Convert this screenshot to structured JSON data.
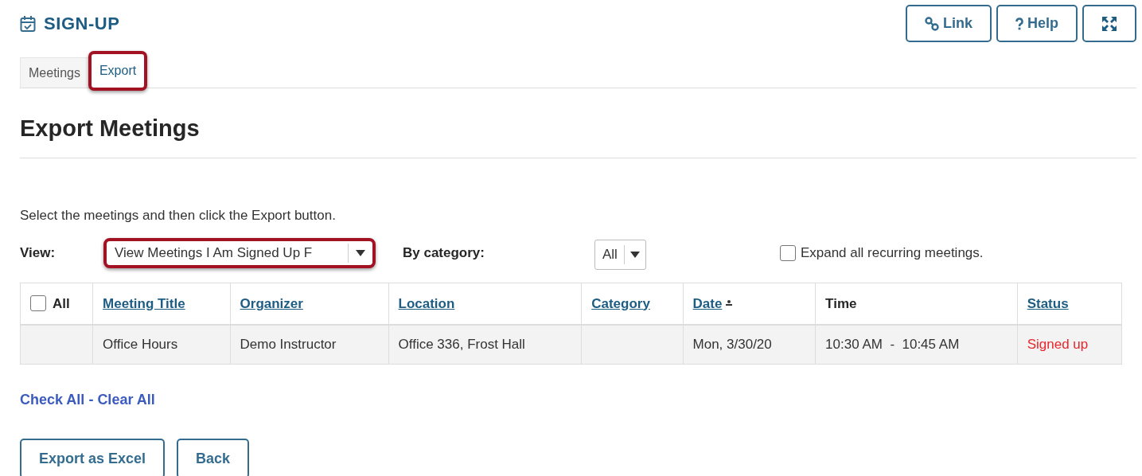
{
  "tool_title": "SIGN-UP",
  "header_buttons": [
    {
      "kind": "link",
      "label": "Link"
    },
    {
      "kind": "help",
      "label": "Help"
    },
    {
      "kind": "fullscreen"
    }
  ],
  "tabs": [
    {
      "label": "Meetings",
      "selected": false,
      "highlighted": false
    },
    {
      "label": "Export",
      "selected": true,
      "highlighted": true
    }
  ],
  "heading": "Export Meetings",
  "instruction": "Select the meetings and then click the Export button.",
  "view": {
    "label": "View:",
    "value": "View Meetings I Am Signed Up F",
    "highlighted": true
  },
  "category": {
    "label": "By category:",
    "value": "All"
  },
  "expand_recurring": {
    "label": "Expand all recurring meetings.",
    "checked": false
  },
  "table": {
    "select_all": {
      "label": "All",
      "checked": false
    },
    "columns": [
      {
        "label": "Meeting Title",
        "sortable": true,
        "sorted": false
      },
      {
        "label": "Organizer",
        "sortable": true,
        "sorted": false
      },
      {
        "label": "Location",
        "sortable": true,
        "sorted": false
      },
      {
        "label": "Category",
        "sortable": true,
        "sorted": false
      },
      {
        "label": "Date",
        "sortable": true,
        "sorted": true
      },
      {
        "label": "Time",
        "sortable": false
      },
      {
        "label": "Status",
        "sortable": true,
        "sorted": false
      }
    ],
    "rows": [
      {
        "cells": [
          "Office Hours",
          "Demo Instructor",
          "Office 336, Frost Hall",
          "",
          "Mon, 3/30/20",
          "10:30 AM  -  10:45 AM",
          "Signed up"
        ],
        "color": "#e8262b"
      }
    ]
  },
  "bulk_links": {
    "check_all": "Check All",
    "separator": "-",
    "clear_all": "Clear All"
  },
  "actions": [
    "Export as Excel",
    "Back"
  ]
}
